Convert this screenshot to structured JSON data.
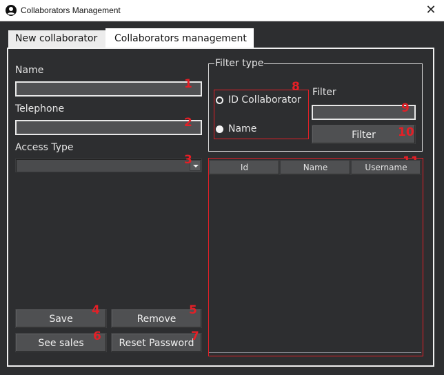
{
  "window": {
    "title": "Collaborators Management",
    "close_glyph": "✕",
    "icon": "user-circle-icon"
  },
  "tabs": [
    {
      "label": "New collaborator",
      "active": false
    },
    {
      "label": "Collaborators management",
      "active": true
    }
  ],
  "form": {
    "name_label": "Name",
    "name_value": "",
    "telephone_label": "Telephone",
    "telephone_value": "",
    "access_type_label": "Access Type",
    "access_type_value": ""
  },
  "filter": {
    "group_title": "Filter type",
    "options": [
      {
        "label": "ID Collaborator",
        "selected": false
      },
      {
        "label": "Name",
        "selected": true
      }
    ],
    "filter_label": "Filter",
    "filter_value": "",
    "filter_button": "Filter"
  },
  "table": {
    "columns": [
      "Id",
      "Name",
      "Username"
    ],
    "rows": []
  },
  "buttons": {
    "save": "Save",
    "remove": "Remove",
    "see_sales": "See sales",
    "reset_password": "Reset Password"
  },
  "markers": [
    "1",
    "2",
    "3",
    "4",
    "5",
    "6",
    "7",
    "8",
    "9",
    "10",
    "11"
  ],
  "colors": {
    "background": "#2d2e30",
    "marker_red": "#e41f26",
    "button": "#4f5052",
    "input": "#505153"
  }
}
